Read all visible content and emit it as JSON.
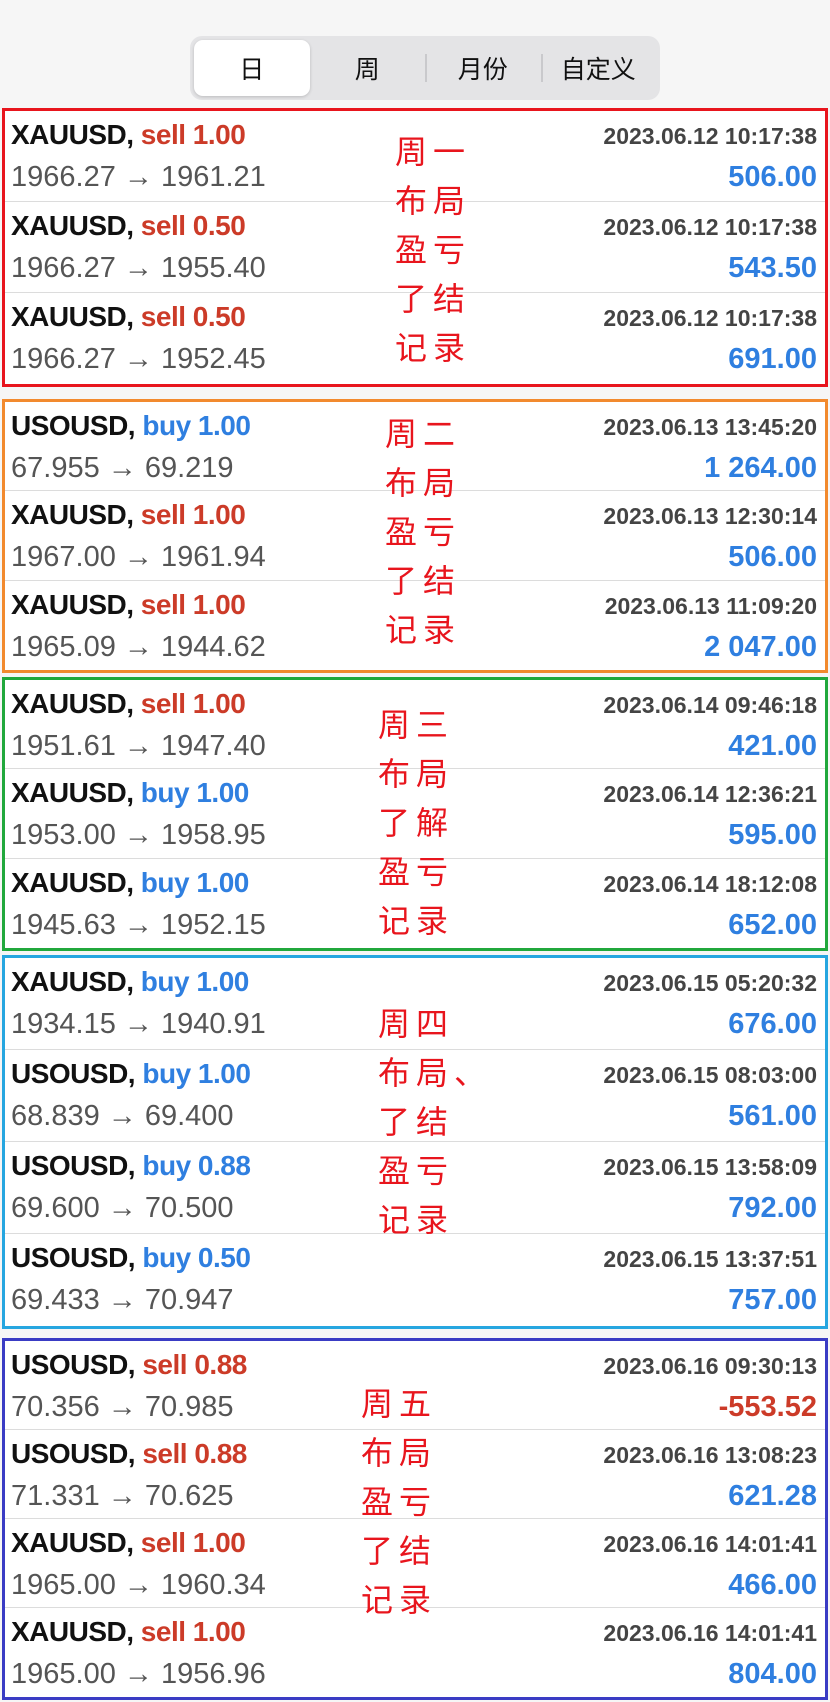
{
  "tabs": [
    "日",
    "周",
    "月份",
    "自定义"
  ],
  "groups": [
    {
      "border_color": "#e8151d",
      "note": [
        "周一",
        "布局",
        "盈亏",
        "了结",
        "记录"
      ],
      "rows": [
        {
          "symbol": "XAUUSD,",
          "side": "sell",
          "volume": "1.00",
          "prices": "1966.27 → 1961.21",
          "time": "2023.06.12 10:17:38",
          "profit": "506.00"
        },
        {
          "symbol": "XAUUSD,",
          "side": "sell",
          "volume": "0.50",
          "prices": "1966.27 → 1955.40",
          "time": "2023.06.12 10:17:38",
          "profit": "543.50"
        },
        {
          "symbol": "XAUUSD,",
          "side": "sell",
          "volume": "0.50",
          "prices": "1966.27 → 1952.45",
          "time": "2023.06.12 10:17:38",
          "profit": "691.00"
        }
      ]
    },
    {
      "border_color": "#f28a2e",
      "note": [
        "周二",
        "布局",
        "盈亏",
        "了结",
        "记录"
      ],
      "rows": [
        {
          "symbol": "USOUSD,",
          "side": "buy",
          "volume": "1.00",
          "prices": "67.955 → 69.219",
          "time": "2023.06.13 13:45:20",
          "profit": "1 264.00"
        },
        {
          "symbol": "XAUUSD,",
          "side": "sell",
          "volume": "1.00",
          "prices": "1967.00 → 1961.94",
          "time": "2023.06.13 12:30:14",
          "profit": "506.00"
        },
        {
          "symbol": "XAUUSD,",
          "side": "sell",
          "volume": "1.00",
          "prices": "1965.09 → 1944.62",
          "time": "2023.06.13 11:09:20",
          "profit": "2 047.00"
        }
      ]
    },
    {
      "border_color": "#21a83c",
      "note": [
        "周三",
        "布局",
        "了解",
        "盈亏",
        "记录"
      ],
      "rows": [
        {
          "symbol": "XAUUSD,",
          "side": "sell",
          "volume": "1.00",
          "prices": "1951.61 → 1947.40",
          "time": "2023.06.14 09:46:18",
          "profit": "421.00"
        },
        {
          "symbol": "XAUUSD,",
          "side": "buy",
          "volume": "1.00",
          "prices": "1953.00 → 1958.95",
          "time": "2023.06.14 12:36:21",
          "profit": "595.00"
        },
        {
          "symbol": "XAUUSD,",
          "side": "buy",
          "volume": "1.00",
          "prices": "1945.63 → 1952.15",
          "time": "2023.06.14 18:12:08",
          "profit": "652.00"
        }
      ]
    },
    {
      "border_color": "#26a6e0",
      "note": [
        "周四",
        "布局、",
        "了结",
        "盈亏",
        "记录"
      ],
      "rows": [
        {
          "symbol": "XAUUSD,",
          "side": "buy",
          "volume": "1.00",
          "prices": "1934.15 → 1940.91",
          "time": "2023.06.15 05:20:32",
          "profit": "676.00"
        },
        {
          "symbol": "USOUSD,",
          "side": "buy",
          "volume": "1.00",
          "prices": "68.839 → 69.400",
          "time": "2023.06.15 08:03:00",
          "profit": "561.00"
        },
        {
          "symbol": "USOUSD,",
          "side": "buy",
          "volume": "0.88",
          "prices": "69.600 → 70.500",
          "time": "2023.06.15 13:58:09",
          "profit": "792.00"
        },
        {
          "symbol": "USOUSD,",
          "side": "buy",
          "volume": "0.50",
          "prices": "69.433 → 70.947",
          "time": "2023.06.15 13:37:51",
          "profit": "757.00"
        }
      ]
    },
    {
      "border_color": "#3a3cc4",
      "note": [
        "周五",
        "布局",
        "盈亏",
        "了结",
        "记录"
      ],
      "rows": [
        {
          "symbol": "USOUSD,",
          "side": "sell",
          "volume": "0.88",
          "prices": "70.356 → 70.985",
          "time": "2023.06.16 09:30:13",
          "profit": "-553.52"
        },
        {
          "symbol": "USOUSD,",
          "side": "sell",
          "volume": "0.88",
          "prices": "71.331 → 70.625",
          "time": "2023.06.16 13:08:23",
          "profit": "621.28"
        },
        {
          "symbol": "XAUUSD,",
          "side": "sell",
          "volume": "1.00",
          "prices": "1965.00 → 1960.34",
          "time": "2023.06.16 14:01:41",
          "profit": "466.00"
        },
        {
          "symbol": "XAUUSD,",
          "side": "sell",
          "volume": "1.00",
          "prices": "1965.00 → 1956.96",
          "time": "2023.06.16 14:01:41",
          "profit": "804.00"
        }
      ]
    }
  ]
}
